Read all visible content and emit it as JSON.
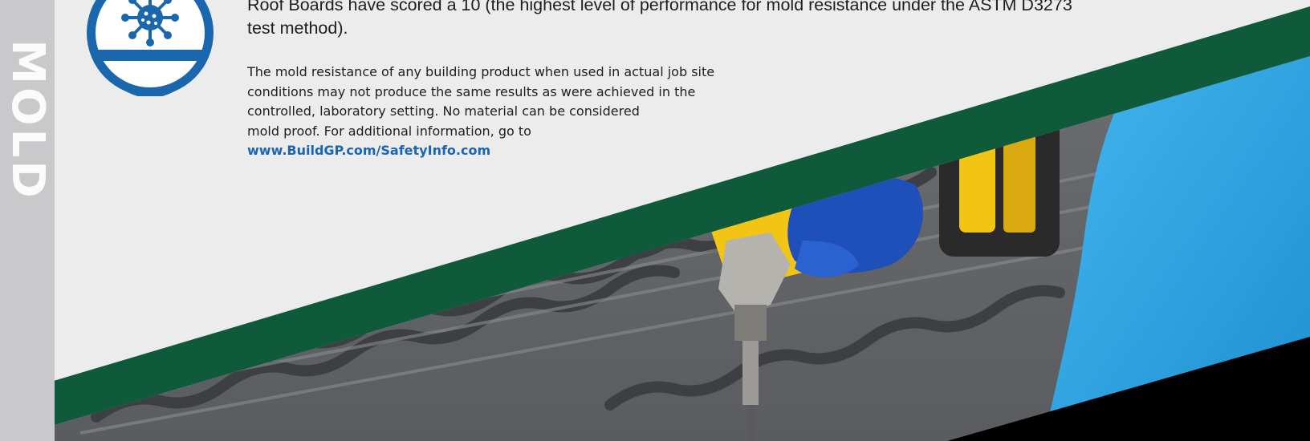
{
  "side_label": "MOLD",
  "heading": "Roof Boards have scored a 10 (the highest level of performance for mold resistance under the ASTM D3273 test method).",
  "note": {
    "lines": [
      "The mold resistance of any building product when used in actual job site",
      "conditions may not produce the same results as were achieved in the",
      "controlled, laboratory setting. No material can be considered",
      "mold proof. For additional information, go to"
    ],
    "link": "www.BuildGP.com/SafetyInfo.com"
  },
  "icons": {
    "mold": "mold-spore-icon"
  },
  "colors": {
    "background": "#ececec",
    "side_band": "#c9c9cb",
    "icon_blue": "#1b67ad",
    "diagonal_green": "#0e5a3a",
    "link_blue": "#1a66b3",
    "glove_blue": "#2ea8e6",
    "drill_yellow": "#f2c414"
  }
}
